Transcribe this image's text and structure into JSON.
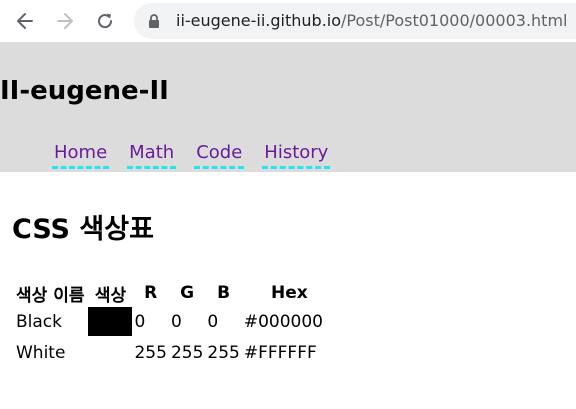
{
  "browser": {
    "url_host": "ii-eugene-ii.github.io",
    "url_path": "/Post/Post01000/00003.html"
  },
  "site": {
    "title": "II-eugene-II",
    "nav": [
      {
        "label": "Home"
      },
      {
        "label": "Math"
      },
      {
        "label": "Code"
      },
      {
        "label": "History"
      }
    ],
    "header_bg": "#dcdcdc",
    "link_color": "#6a1b9a",
    "link_underline_color": "#29e3f0"
  },
  "page": {
    "title": "CSS 색상표",
    "table": {
      "headers": [
        "색상 이름",
        "색상",
        "R",
        "G",
        "B",
        "Hex"
      ],
      "rows": [
        {
          "name": "Black",
          "swatch": "#000000",
          "r": "0",
          "g": "0",
          "b": "0",
          "hex": "#000000"
        },
        {
          "name": "White",
          "swatch": "#FFFFFF",
          "r": "255",
          "g": "255",
          "b": "255",
          "hex": "#FFFFFF"
        }
      ]
    }
  }
}
